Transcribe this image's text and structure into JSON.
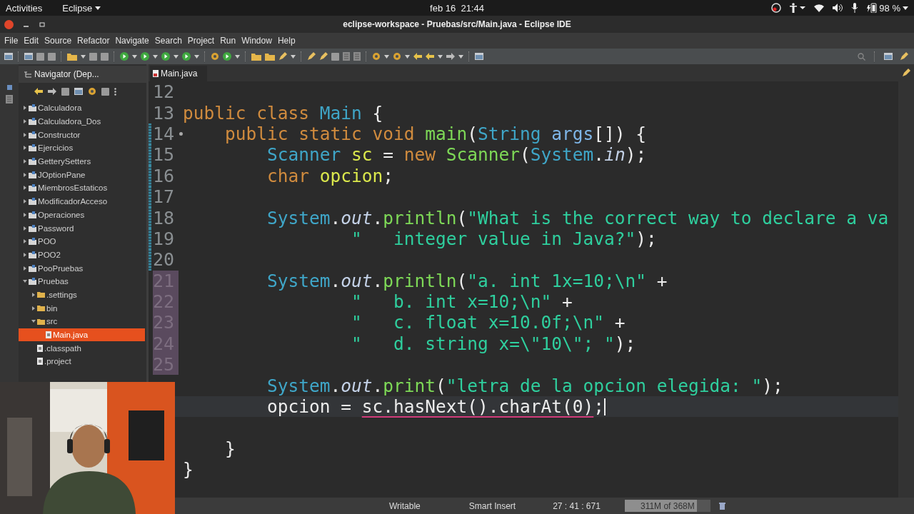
{
  "top_bar": {
    "activities": "Activities",
    "app_menu": "Eclipse",
    "clock": "feb 16  21:44",
    "battery": "98 %"
  },
  "window": {
    "title": "eclipse-workspace - Pruebas/src/Main.java - Eclipse IDE"
  },
  "menu": [
    "File",
    "Edit",
    "Source",
    "Refactor",
    "Navigate",
    "Search",
    "Project",
    "Run",
    "Window",
    "Help"
  ],
  "navigator": {
    "title": "Navigator (Dep...",
    "items": [
      {
        "label": "Calculadora",
        "kind": "project",
        "expanded": false
      },
      {
        "label": "Calculadora_Dos",
        "kind": "project",
        "expanded": false
      },
      {
        "label": "Constructor",
        "kind": "project",
        "expanded": false
      },
      {
        "label": "Ejercicios",
        "kind": "project",
        "expanded": false
      },
      {
        "label": "GetterySetters",
        "kind": "project",
        "expanded": false
      },
      {
        "label": "JOptionPane",
        "kind": "project",
        "expanded": false
      },
      {
        "label": "MiembrosEstaticos",
        "kind": "project",
        "expanded": false
      },
      {
        "label": "ModificadorAcceso",
        "kind": "project",
        "expanded": false
      },
      {
        "label": "Operaciones",
        "kind": "project",
        "expanded": false
      },
      {
        "label": "Password",
        "kind": "project",
        "expanded": false
      },
      {
        "label": "POO",
        "kind": "project",
        "expanded": false
      },
      {
        "label": "POO2",
        "kind": "project",
        "expanded": false
      },
      {
        "label": "PooPruebas",
        "kind": "project",
        "expanded": false
      },
      {
        "label": "Pruebas",
        "kind": "project",
        "expanded": true,
        "children": [
          {
            "label": ".settings",
            "kind": "folder",
            "expanded": false
          },
          {
            "label": "bin",
            "kind": "folder",
            "expanded": false
          },
          {
            "label": "src",
            "kind": "folder",
            "expanded": true,
            "children": [
              {
                "label": "Main.java",
                "kind": "file",
                "selected": true
              }
            ]
          },
          {
            "label": ".classpath",
            "kind": "file",
            "selected": false
          },
          {
            "label": ".project",
            "kind": "file",
            "selected": false
          }
        ]
      }
    ]
  },
  "editor": {
    "tab": "Main.java",
    "lines": [
      {
        "number": "12",
        "modified": false,
        "highlighted": false
      },
      {
        "number": "13",
        "modified": false,
        "highlighted": false,
        "kind": "class",
        "tokens": [
          {
            "kind": "keyword",
            "text": "public "
          },
          {
            "kind": "keyword",
            "text": "class "
          },
          {
            "kind": "type",
            "text": "Main "
          },
          {
            "kind": "plain",
            "text": "{"
          }
        ]
      },
      {
        "number": "14",
        "modified": true,
        "highlighted": false,
        "fold": true,
        "kind": "member",
        "tokens": [
          {
            "kind": "keyword",
            "text": "public "
          },
          {
            "kind": "keyword",
            "text": "static "
          },
          {
            "kind": "keyword",
            "text": "void "
          },
          {
            "kind": "method",
            "text": "main"
          },
          {
            "kind": "plain",
            "text": "("
          },
          {
            "kind": "type",
            "text": "String "
          },
          {
            "kind": "param",
            "text": "args"
          },
          {
            "kind": "plain",
            "text": "[]) {"
          }
        ]
      },
      {
        "number": "15",
        "modified": true,
        "highlighted": false,
        "kind": "statement",
        "tokens": [
          {
            "kind": "type",
            "text": "Scanner "
          },
          {
            "kind": "var",
            "text": "sc "
          },
          {
            "kind": "plain",
            "text": "= "
          },
          {
            "kind": "keyword",
            "text": "new "
          },
          {
            "kind": "method",
            "text": "Scanner"
          },
          {
            "kind": "plain",
            "text": "("
          },
          {
            "kind": "type",
            "text": "System"
          },
          {
            "kind": "plain",
            "text": "."
          },
          {
            "kind": "field",
            "text": "in"
          },
          {
            "kind": "plain",
            "text": ");"
          }
        ]
      },
      {
        "number": "16",
        "modified": true,
        "highlighted": false,
        "kind": "statement",
        "tokens": [
          {
            "kind": "keyword",
            "text": "char "
          },
          {
            "kind": "var",
            "text": "opcion"
          },
          {
            "kind": "plain",
            "text": ";"
          }
        ]
      },
      {
        "number": "17",
        "modified": true,
        "highlighted": false
      },
      {
        "number": "18",
        "modified": true,
        "highlighted": false,
        "kind": "statement",
        "tokens": [
          {
            "kind": "type",
            "text": "System"
          },
          {
            "kind": "plain",
            "text": "."
          },
          {
            "kind": "field",
            "text": "out"
          },
          {
            "kind": "plain",
            "text": "."
          },
          {
            "kind": "method",
            "text": "println"
          },
          {
            "kind": "plain",
            "text": "("
          },
          {
            "kind": "string",
            "text": "\"What is the correct way to declare a va"
          }
        ]
      },
      {
        "number": "19",
        "modified": true,
        "highlighted": false,
        "kind": "continuation",
        "tokens": [
          {
            "kind": "string",
            "text": "\"   integer value in Java?\""
          },
          {
            "kind": "plain",
            "text": ");"
          }
        ]
      },
      {
        "number": "20",
        "modified": true,
        "highlighted": false
      },
      {
        "number": "21",
        "modified": false,
        "highlighted": true,
        "kind": "statement",
        "tokens": [
          {
            "kind": "type",
            "text": "System"
          },
          {
            "kind": "plain",
            "text": "."
          },
          {
            "kind": "field",
            "text": "out"
          },
          {
            "kind": "plain",
            "text": "."
          },
          {
            "kind": "method",
            "text": "println"
          },
          {
            "kind": "plain",
            "text": "("
          },
          {
            "kind": "string",
            "text": "\"a. int 1x=10;\\n\" "
          },
          {
            "kind": "plain",
            "text": "+"
          }
        ]
      },
      {
        "number": "22",
        "modified": false,
        "highlighted": true,
        "kind": "continuation",
        "tokens": [
          {
            "kind": "string",
            "text": "\"   b. int x=10;\\n\" "
          },
          {
            "kind": "plain",
            "text": "+"
          }
        ]
      },
      {
        "number": "23",
        "modified": false,
        "highlighted": true,
        "kind": "continuation",
        "tokens": [
          {
            "kind": "string",
            "text": "\"   c. float x=10.0f;\\n\" "
          },
          {
            "kind": "plain",
            "text": "+"
          }
        ]
      },
      {
        "number": "24",
        "modified": false,
        "highlighted": true,
        "kind": "continuation",
        "tokens": [
          {
            "kind": "string",
            "text": "\"   d. string x=\\\"10\\\"; \""
          },
          {
            "kind": "plain",
            "text": ");"
          }
        ]
      },
      {
        "number": "25",
        "modified": false,
        "highlighted": true
      },
      {
        "kind": "statement",
        "tokens": [
          {
            "kind": "type",
            "text": "System"
          },
          {
            "kind": "plain",
            "text": "."
          },
          {
            "kind": "field",
            "text": "out"
          },
          {
            "kind": "plain",
            "text": "."
          },
          {
            "kind": "method",
            "text": "print"
          },
          {
            "kind": "plain",
            "text": "("
          },
          {
            "kind": "string",
            "text": "\"letra de la opcion elegida: \""
          },
          {
            "kind": "plain",
            "text": ");"
          }
        ]
      },
      {
        "current": true,
        "kind": "statement",
        "tokens": [
          {
            "kind": "plain",
            "text": "opcion = "
          },
          {
            "kind": "plain",
            "text": "sc.hasNext().charAt(0)",
            "error": true
          },
          {
            "kind": "plain",
            "text": ";"
          }
        ]
      },
      {
        "current": false
      },
      {
        "kind": "member",
        "tokens": [
          {
            "kind": "plain",
            "text": "}"
          }
        ]
      },
      {
        "kind": "class",
        "tokens": [
          {
            "kind": "plain",
            "text": "}"
          }
        ]
      }
    ]
  },
  "status_bar": {
    "mode": "Writable",
    "insert": "Smart Insert",
    "position": "27 : 41 : 671",
    "memory": "311M of 368M",
    "level": 0.845
  }
}
